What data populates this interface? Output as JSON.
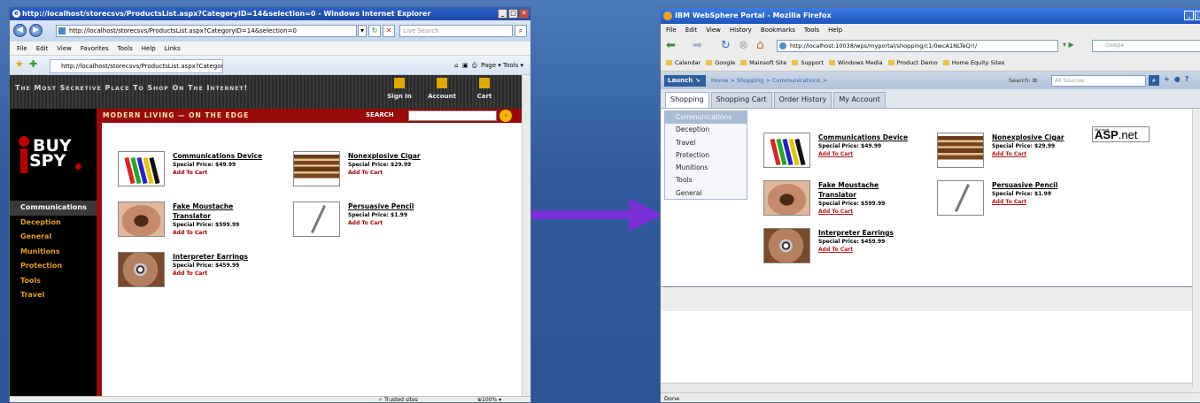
{
  "ie": {
    "title": "http://localhost/storecsvs/ProductsList.aspx?CategoryID=14&selection=0 - Windows Internet Explorer",
    "address": "http://localhost/storecsvs/ProductsList.aspx?CategoryID=14&selection=0",
    "search_placeholder": "Live Search",
    "menu": [
      "File",
      "Edit",
      "View",
      "Favorites",
      "Tools",
      "Help",
      "Links"
    ],
    "tab_title": "http://localhost/storecsvs/ProductsList.aspx?Categor....",
    "toolbar_right": "Page ▾  Tools ▾",
    "slogan": "The Most Secretive Place To Shop On The Internet!",
    "nav": [
      "Sign In",
      "Account",
      "Cart"
    ],
    "tagline": "MODERN LIVING — ON THE EDGE",
    "search_label": "SEARCH",
    "logo_line1": "BUY",
    "logo_line2": "SPY",
    "categories": [
      "Communications",
      "Deception",
      "General",
      "Munitions",
      "Protection",
      "Tools",
      "Travel"
    ],
    "status_zone": "Trusted sites",
    "zoom": "100%"
  },
  "products": [
    {
      "name_line1": "Communications Device",
      "name_line2": "",
      "price": "Special Price: $49.99",
      "thumb": "crayons-image"
    },
    {
      "name_line1": "Nonexplosive Cigar",
      "name_line2": "",
      "price": "Special Price: $29.99",
      "thumb": "cigar-image"
    },
    {
      "name_line1": "Fake Moustache",
      "name_line2": "Translator",
      "price": "Special Price: $599.99",
      "thumb": "moustache-image"
    },
    {
      "name_line1": "Persuasive Pencil",
      "name_line2": "",
      "price": "Special Price: $1.99",
      "thumb": "pencil-image"
    },
    {
      "name_line1": "Interpreter Earrings",
      "name_line2": "",
      "price": "Special Price: $459.99",
      "thumb": "earring-image"
    }
  ],
  "add_to_cart": "Add To Cart",
  "ff": {
    "title": "IBM WebSphere Portal - Mozilla Firefox",
    "menu": [
      "File",
      "Edit",
      "View",
      "History",
      "Bookmarks",
      "Tools",
      "Help"
    ],
    "address": "http://localhost:10038/wps/myportal/shopping/c1/0wcA1NLTeQ!!/",
    "search_placeholder": "Google",
    "bookmarks": [
      "Calendar",
      "Google",
      "Mainsoft Site",
      "Support",
      "Windows Media",
      "Product Demo",
      "Home Equity Sites"
    ],
    "launch": "Launch",
    "breadcrumb": "Home > Shopping > Communications >",
    "portal_search_label": "Search:",
    "portal_search_placeholder": "All Sources",
    "tabs": [
      "Shopping",
      "Shopping Cart",
      "Order History",
      "My Account"
    ],
    "categories": [
      "Communications",
      "Deception",
      "Travel",
      "Protection",
      "Munitions",
      "Tools",
      "General"
    ],
    "aspnet_small": "Microsoft",
    "aspnet_text": "ASP",
    "aspnet_suffix": ".net",
    "status": "Done"
  },
  "colors": {
    "ie_red": "#9a0a0a",
    "ie_category": "#e0a020",
    "portal_blue": "#2e5f9e",
    "arrow": "#7b2fd6"
  }
}
